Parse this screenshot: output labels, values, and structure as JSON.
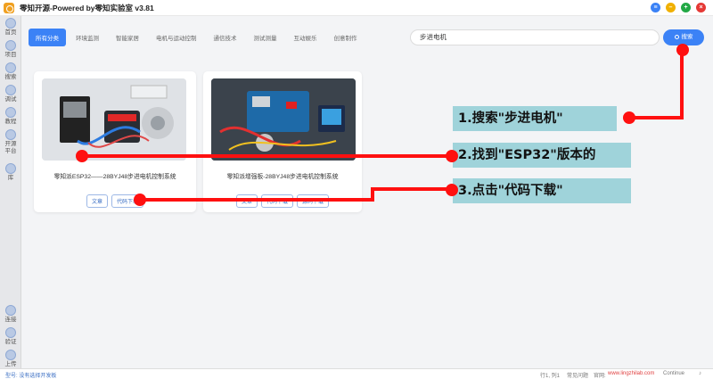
{
  "window": {
    "title": "零知开源-Powered by零知实验室 v3.81"
  },
  "sidebar": {
    "items": [
      {
        "label": "首页"
      },
      {
        "label": "项目"
      },
      {
        "label": "搜索"
      },
      {
        "label": "调试"
      },
      {
        "label": "教程"
      },
      {
        "label": "开源平台"
      },
      {
        "label": "库"
      }
    ],
    "bottom_items": [
      {
        "label": "连接"
      },
      {
        "label": "验证"
      },
      {
        "label": "上传"
      }
    ]
  },
  "tabs": [
    {
      "label": "所有分类",
      "active": true
    },
    {
      "label": "环境监测"
    },
    {
      "label": "智能家居"
    },
    {
      "label": "电机与运动控制"
    },
    {
      "label": "通信技术"
    },
    {
      "label": "测试测量"
    },
    {
      "label": "互动娱乐"
    },
    {
      "label": "创意制作"
    }
  ],
  "search": {
    "value": "步进电机",
    "button_label": "搜索"
  },
  "cards": [
    {
      "title": "零知派ESP32——28BYJ48步进电机控制系统",
      "buttons": [
        "文章",
        "代码下载"
      ]
    },
    {
      "title": "零知派增强板-28BYJ48步进电机控制系统",
      "buttons": [
        "文章",
        "代码下载",
        "源码下载"
      ]
    }
  ],
  "annotations": [
    "1.搜索\"步进电机\"",
    "2.找到\"ESP32\"版本的",
    "3.点击\"代码下载\""
  ],
  "statusbar": {
    "left": "型号: 没有选择开发板",
    "position": "行1, 列1",
    "faq": "常见问题",
    "site_label": "官网:",
    "site": "www.lingzhilab.com",
    "continue": "Continue"
  },
  "colors": {
    "accent": "#3b82f6",
    "annotation": "#ff1010",
    "annotation_box": "#9fd3da"
  }
}
